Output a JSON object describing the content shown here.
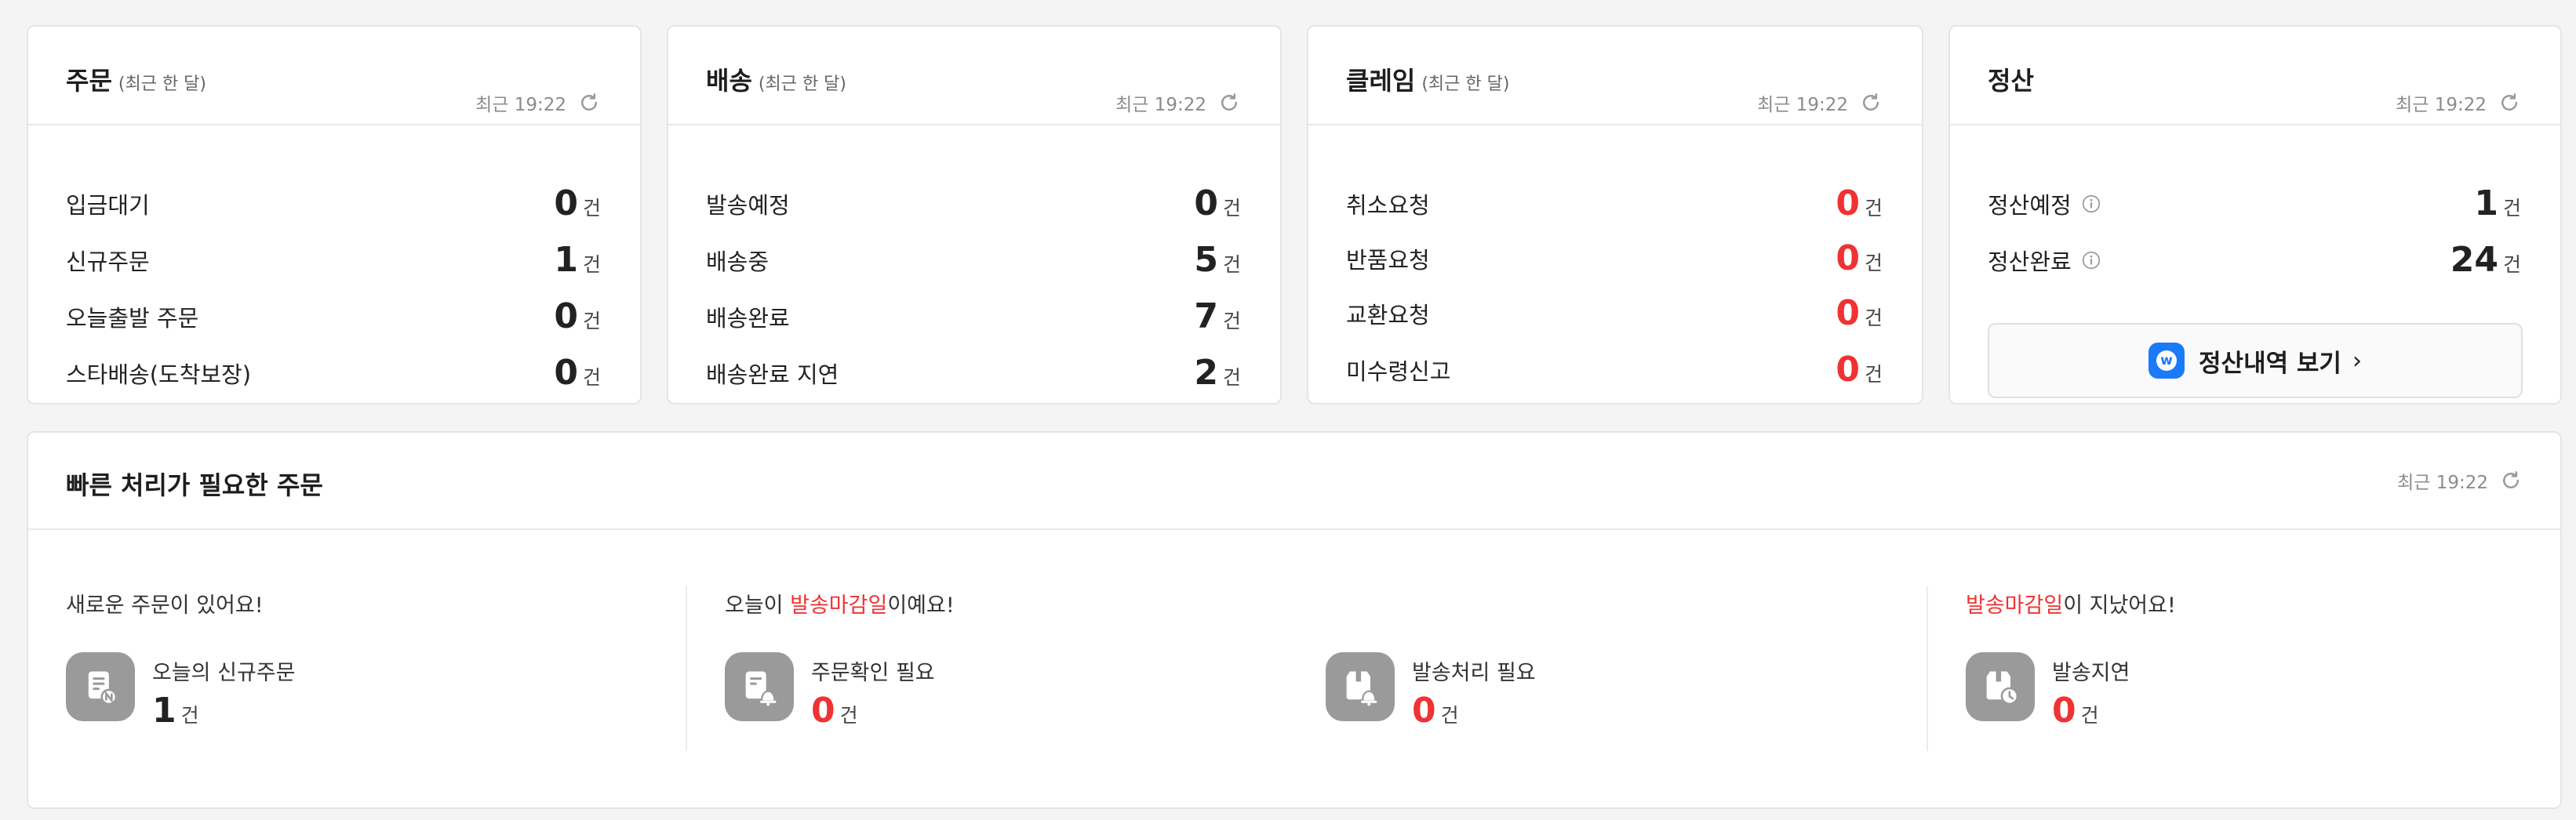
{
  "cards": [
    {
      "title": "주문",
      "subtitle": "(최근 한 달)",
      "time": "최근 19:22",
      "rows": [
        {
          "label": "입금대기",
          "value": "0",
          "unit": "건"
        },
        {
          "label": "신규주문",
          "value": "1",
          "unit": "건"
        },
        {
          "label": "오늘출발 주문",
          "value": "0",
          "unit": "건"
        },
        {
          "label": "스타배송(도착보장)",
          "value": "0",
          "unit": "건"
        }
      ]
    },
    {
      "title": "배송",
      "subtitle": "(최근 한 달)",
      "time": "최근 19:22",
      "rows": [
        {
          "label": "발송예정",
          "value": "0",
          "unit": "건"
        },
        {
          "label": "배송중",
          "value": "5",
          "unit": "건"
        },
        {
          "label": "배송완료",
          "value": "7",
          "unit": "건"
        },
        {
          "label": "배송완료 지연",
          "value": "2",
          "unit": "건"
        }
      ]
    },
    {
      "title": "클레임",
      "subtitle": "(최근 한 달)",
      "time": "최근 19:22",
      "rows": [
        {
          "label": "취소요청",
          "value": "0",
          "unit": "건"
        },
        {
          "label": "반품요청",
          "value": "0",
          "unit": "건"
        },
        {
          "label": "교환요청",
          "value": "0",
          "unit": "건"
        },
        {
          "label": "미수령신고",
          "value": "0",
          "unit": "건"
        }
      ]
    },
    {
      "title": "정산",
      "time": "최근 19:22",
      "rows": [
        {
          "label": "정산예정",
          "value": "1",
          "unit": "건"
        },
        {
          "label": "정산완료",
          "value": "24",
          "unit": "건"
        }
      ],
      "button_label": "정산내역 보기",
      "button_badge": "w"
    }
  ],
  "urgent": {
    "title": "빠른 처리가 필요한 주문",
    "time": "최근 19:22",
    "sections": [
      {
        "head_pre": "새로운 주문이 있어요!",
        "head_hl": "",
        "head_post": ""
      },
      {
        "head_pre": "오늘이 ",
        "head_hl": "발송마감일",
        "head_post": "이예요!"
      },
      {
        "head_pre": "",
        "head_hl": "발송마감일",
        "head_post": "이 지났어요!"
      }
    ],
    "stats": [
      {
        "label": "오늘의 신규주문",
        "value": "1",
        "unit": "건"
      },
      {
        "label": "주문확인 필요",
        "value": "0",
        "unit": "건"
      },
      {
        "label": "발송처리 필요",
        "value": "0",
        "unit": "건"
      },
      {
        "label": "발송지연",
        "value": "0",
        "unit": "건"
      }
    ]
  },
  "colors": {
    "accent_red": "#f03232",
    "brand_blue": "#1a7af8",
    "icon_gray": "#9a9a9a"
  }
}
